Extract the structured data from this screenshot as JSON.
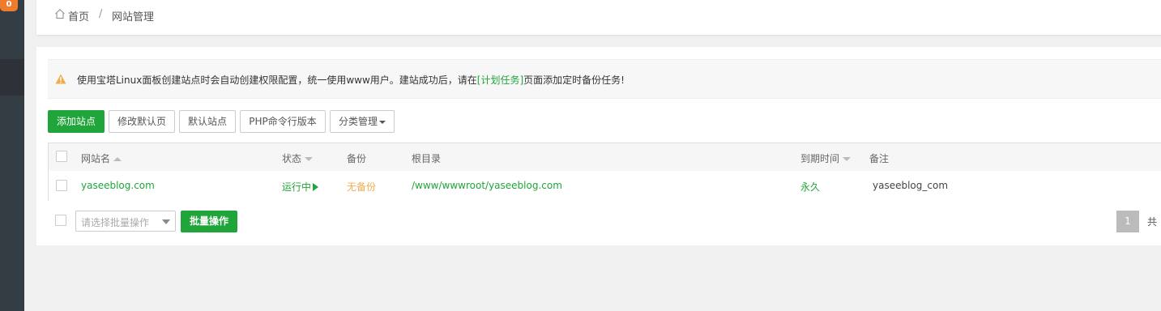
{
  "sidebar": {
    "badge": "0"
  },
  "breadcrumb": {
    "home": "首页",
    "separator": "/",
    "current": "网站管理"
  },
  "notice": {
    "text_before": "使用宝塔Linux面板创建站点时会自动创建权限配置，统一使用www用户。建站成功后，请在",
    "link": "[计划任务]",
    "text_after": "页面添加定时备份任务!"
  },
  "toolbar": {
    "add_site": "添加站点",
    "edit_default_page": "修改默认页",
    "default_site": "默认站点",
    "php_cli_version": "PHP命令行版本",
    "category_manage": "分类管理"
  },
  "table": {
    "headers": {
      "name": "网站名",
      "status": "状态",
      "backup": "备份",
      "root": "根目录",
      "expire": "到期时间",
      "remark": "备注"
    },
    "rows": [
      {
        "name": "yaseeblog.com",
        "status": "运行中",
        "backup": "无备份",
        "root": "/www/wwwroot/yaseeblog.com",
        "expire": "永久",
        "remark": "yaseeblog_com"
      }
    ]
  },
  "batch": {
    "placeholder": "请选择批量操作",
    "button": "批量操作"
  },
  "pagination": {
    "current": "1",
    "total_label": "共"
  },
  "colors": {
    "accent": "#20a53a",
    "warning": "#f0ad4e",
    "sidebar": "#353d44"
  }
}
